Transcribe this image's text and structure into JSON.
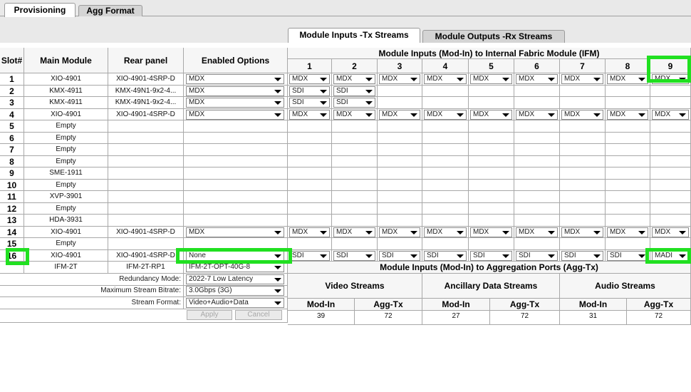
{
  "tabs": [
    "Provisioning",
    "Agg Format"
  ],
  "subtabs": [
    "Module Inputs -Tx Streams",
    "Module Outputs -Rx Streams"
  ],
  "headers": {
    "slot": "Slot#",
    "main_module": "Main Module",
    "rear_panel": "Rear panel",
    "enabled_options": "Enabled Options",
    "ifm_title": "Module Inputs (Mod-In) to Internal Fabric Module (IFM)",
    "ifm_cols": [
      "1",
      "2",
      "3",
      "4",
      "5",
      "6",
      "7",
      "8",
      "9"
    ],
    "agg_title": "Module Inputs (Mod-In) to Aggregation Ports (Agg-Tx)"
  },
  "rows": [
    {
      "slot": "1",
      "main": "XIO-4901",
      "rear": "XIO-4901-4SRP-D",
      "opt": "MDX",
      "ins": [
        "MDX",
        "MDX",
        "MDX",
        "MDX",
        "MDX",
        "MDX",
        "MDX",
        "MDX",
        "MDX"
      ]
    },
    {
      "slot": "2",
      "main": "KMX-4911",
      "rear": "KMX-49N1-9x2-4...",
      "opt": "MDX",
      "ins": [
        "SDI",
        "SDI"
      ]
    },
    {
      "slot": "3",
      "main": "KMX-4911",
      "rear": "KMX-49N1-9x2-4...",
      "opt": "MDX",
      "ins": [
        "SDI",
        "SDI"
      ]
    },
    {
      "slot": "4",
      "main": "XIO-4901",
      "rear": "XIO-4901-4SRP-D",
      "opt": "MDX",
      "ins": [
        "MDX",
        "MDX",
        "MDX",
        "MDX",
        "MDX",
        "MDX",
        "MDX",
        "MDX",
        "MDX"
      ]
    },
    {
      "slot": "5",
      "main": "Empty",
      "rear": "",
      "opt": "",
      "ins": []
    },
    {
      "slot": "6",
      "main": "Empty",
      "rear": "",
      "opt": "",
      "ins": []
    },
    {
      "slot": "7",
      "main": "Empty",
      "rear": "",
      "opt": "",
      "ins": []
    },
    {
      "slot": "8",
      "main": "Empty",
      "rear": "",
      "opt": "",
      "ins": []
    },
    {
      "slot": "9",
      "main": "SME-1911",
      "rear": "",
      "opt": "",
      "ins": []
    },
    {
      "slot": "10",
      "main": "Empty",
      "rear": "",
      "opt": "",
      "ins": []
    },
    {
      "slot": "11",
      "main": "XVP-3901",
      "rear": "",
      "opt": "",
      "ins": []
    },
    {
      "slot": "12",
      "main": "Empty",
      "rear": "",
      "opt": "",
      "ins": []
    },
    {
      "slot": "13",
      "main": "HDA-3931",
      "rear": "",
      "opt": "",
      "ins": []
    },
    {
      "slot": "14",
      "main": "XIO-4901",
      "rear": "XIO-4901-4SRP-D",
      "opt": "MDX",
      "ins": [
        "MDX",
        "MDX",
        "MDX",
        "MDX",
        "MDX",
        "MDX",
        "MDX",
        "MDX",
        "MDX"
      ]
    },
    {
      "slot": "15",
      "main": "Empty",
      "rear": "",
      "opt": "",
      "ins": []
    },
    {
      "slot": "16",
      "main": "XIO-4901",
      "rear": "XIO-4901-4SRP-D",
      "opt": "None",
      "ins": [
        "SDI",
        "SDI",
        "SDI",
        "SDI",
        "SDI",
        "SDI",
        "SDI",
        "SDI",
        "MADI"
      ]
    },
    {
      "slot": "",
      "main": "IFM-2T",
      "rear": "IFM-2T-RP1",
      "opt": "IFM-2T-OPT-40G-8",
      "ins": []
    }
  ],
  "settings": {
    "redundancy_label": "Redundancy Mode:",
    "redundancy_value": "2022-7 Low Latency",
    "bitrate_label": "Maximum Stream Bitrate:",
    "bitrate_value": "3.0Gbps (3G)",
    "format_label": "Stream Format:",
    "format_value": "Video+Audio+Data",
    "apply": "Apply",
    "cancel": "Cancel"
  },
  "agg": {
    "groups": [
      "Video Streams",
      "Ancillary Data Streams",
      "Audio Streams"
    ],
    "mod_in": "Mod-In",
    "agg_tx": "Agg-Tx",
    "values": [
      [
        "39",
        "72"
      ],
      [
        "27",
        "72"
      ],
      [
        "31",
        "72"
      ]
    ]
  },
  "highlight_color": "#21e021"
}
